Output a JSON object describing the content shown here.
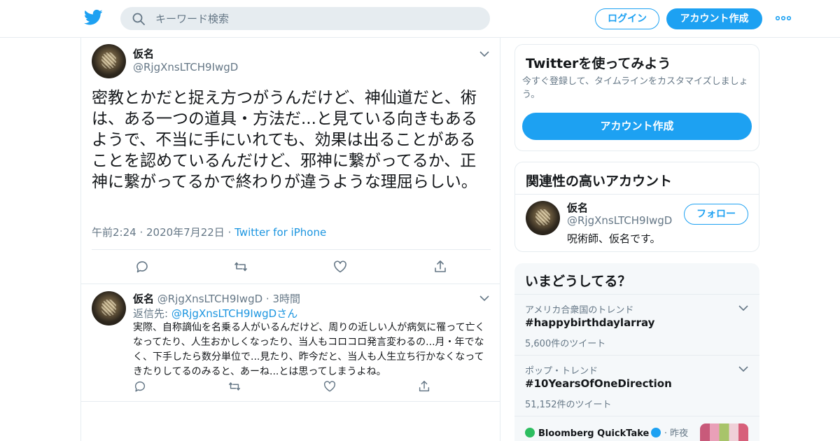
{
  "header": {
    "search_placeholder": "キーワード検索",
    "login_label": "ログイン",
    "signup_label": "アカウント作成"
  },
  "main_tweet": {
    "name": "仮名",
    "handle": "@RjgXnsLTCH9IwgD",
    "text": "密教とかだと捉え方つがうんだけど、神仙道だと、術は、ある一つの道具・方法だ...と見ている向きもあるようで、不当に手にいれても、効果は出ることがあることを認めているんだけど、邪神に繋がってるか、正神に繋がってるかで終わりが違うような理屈らしい。",
    "time": "午前2:24",
    "date": "2020年7月22日",
    "source": "Twitter for iPhone"
  },
  "reply_tweet": {
    "name": "仮名",
    "handle": "@RjgXnsLTCH9IwgD",
    "time": "3時間",
    "reply_to_label": "返信先:",
    "reply_to_handle": "@RjgXnsLTCH9IwgD",
    "reply_to_suffix": "さん",
    "text": "実際、自称謫仙を名乗る人がいるんだけど、周りの近しい人が病気に罹って亡くなってたり、人生おかしくなったり、当人もコロコロ発言変わるの...月・年でなく、下手したら数分単位で...見たり、昨今だと、当人も人生立ち行かなくなってきたりしてるのみると、あーね...とは思ってしまうよね。"
  },
  "sidebar": {
    "try": {
      "title": "Twitterを使ってみよう",
      "subtitle": "今すぐ登録して、タイムラインをカスタマイズしましょう。",
      "button": "アカウント作成"
    },
    "related": {
      "title": "関連性の高いアカウント",
      "name": "仮名",
      "handle": "@RjgXnsLTCH9IwgD",
      "bio": "呪術師、仮名です。",
      "follow": "フォロー"
    },
    "trends": {
      "title": "いまどうしてる？",
      "items": [
        {
          "context": "アメリカ合衆国のトレンド",
          "name": "#happybirthdaylarray",
          "count": "5,600件のツイート"
        },
        {
          "context": "ポップ・トレンド",
          "name": "#10YearsOfOneDirection",
          "count": "51,152件のツイート"
        }
      ],
      "news": {
        "source": "Bloomberg QuickTake",
        "time": "昨夜"
      }
    }
  },
  "colors": {
    "accent": "#1da1f2",
    "link": "#1b95e0",
    "muted": "#657786",
    "border": "#e6ecf0"
  }
}
